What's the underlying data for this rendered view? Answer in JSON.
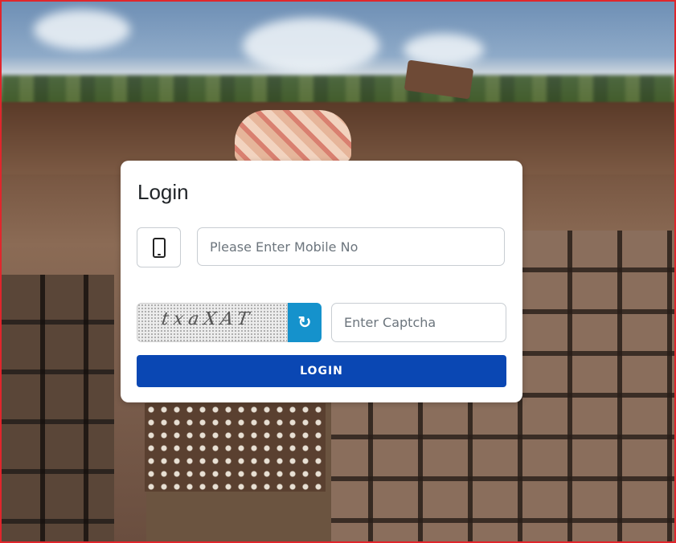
{
  "login": {
    "title": "Login",
    "mobile_icon": "mobile-phone-icon",
    "mobile_placeholder": "Please Enter Mobile No",
    "mobile_value": "",
    "captcha_image_text": "txaXAT",
    "refresh_icon": "refresh-icon",
    "captcha_placeholder": "Enter Captcha",
    "captcha_value": "",
    "submit_label": "LOGIN"
  },
  "colors": {
    "login_button": "#0a47b3",
    "refresh_button": "#1592cc",
    "frame_border": "#e0262c"
  }
}
